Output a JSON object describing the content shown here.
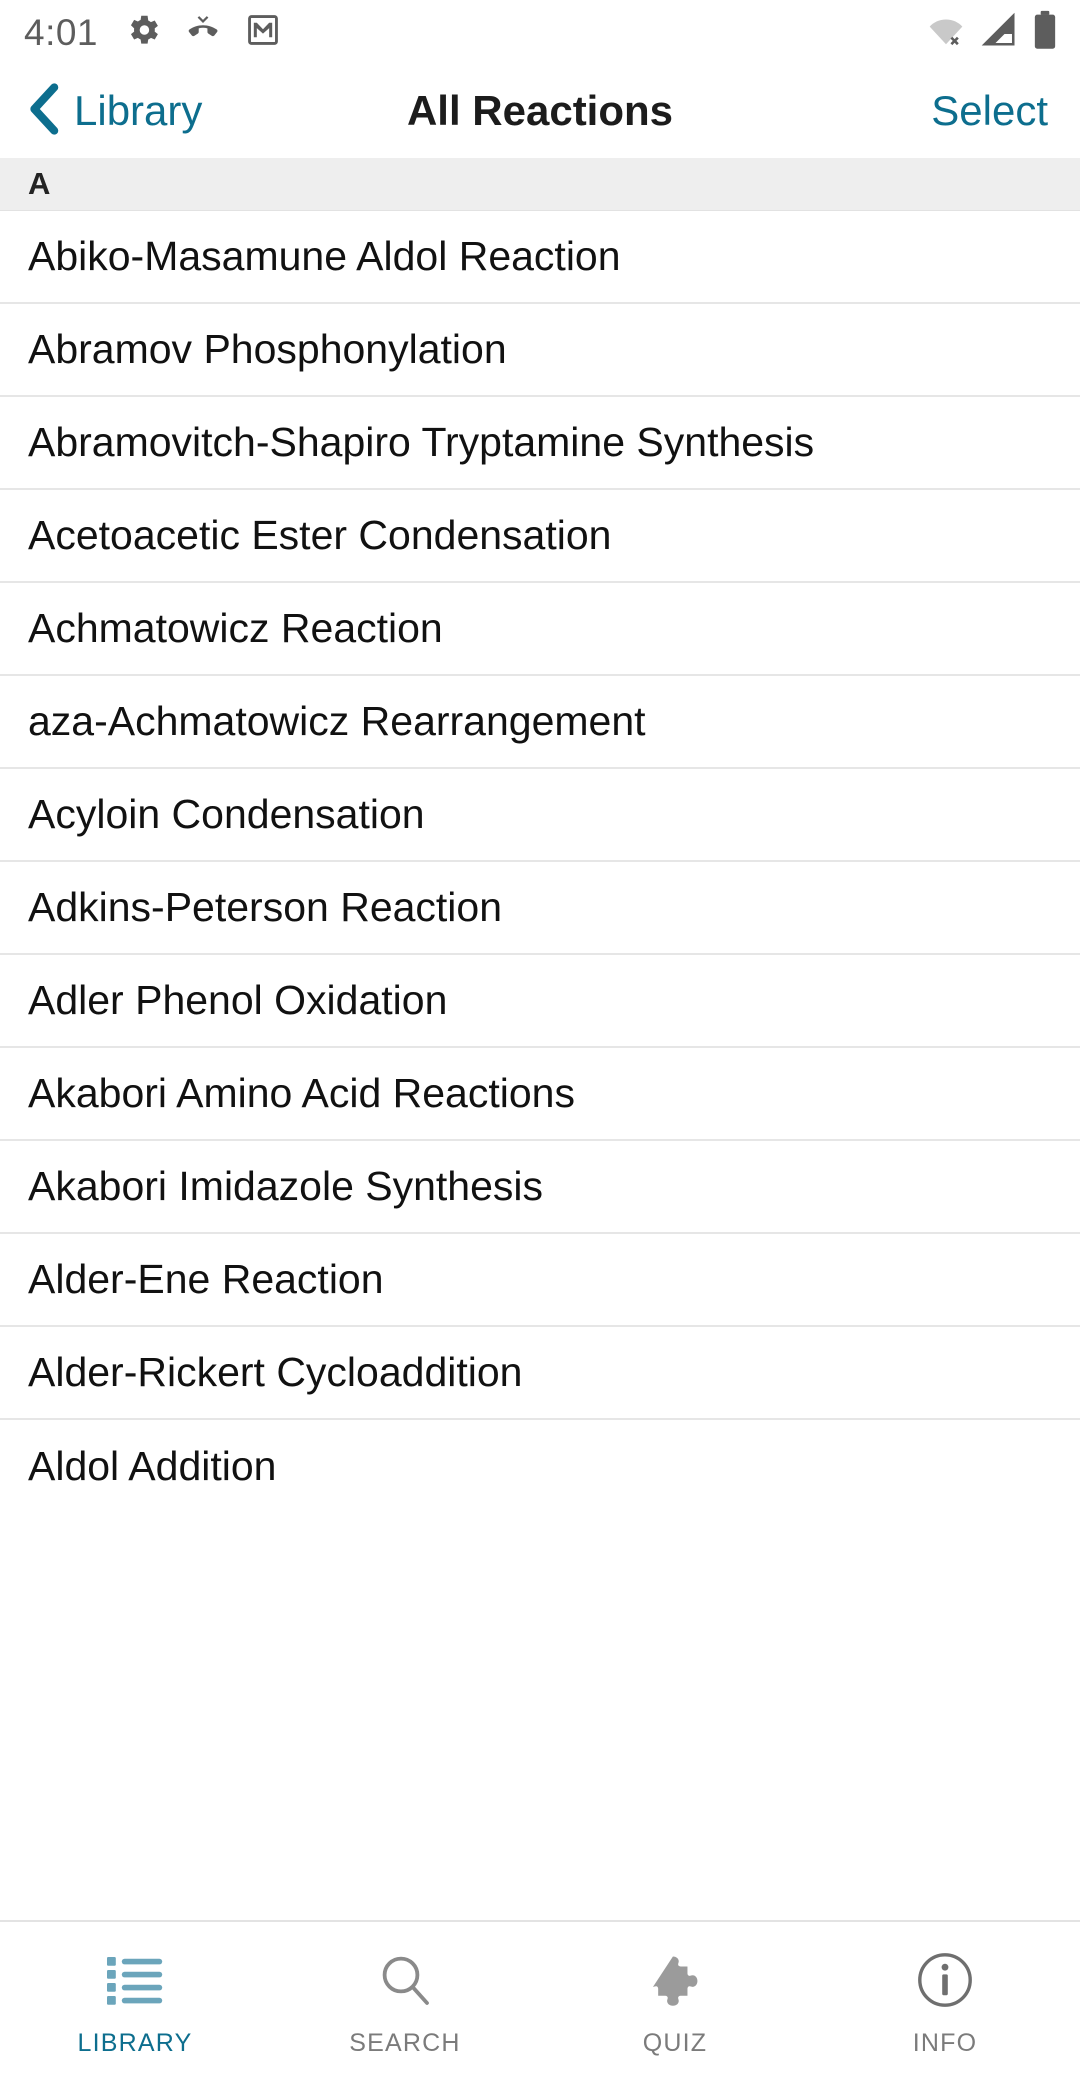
{
  "status_bar": {
    "time": "4:01",
    "left_icons": [
      "settings-gear-icon",
      "missed-call-icon",
      "gmail-icon"
    ],
    "right_icons": [
      "wifi-disconnected-icon",
      "cellular-signal-icon",
      "battery-full-icon"
    ]
  },
  "nav": {
    "back_label": "Library",
    "back_icon": "chevron-left-icon",
    "title": "All Reactions",
    "select_label": "Select"
  },
  "list": {
    "section_letter": "A",
    "items": [
      "Abiko-Masamune Aldol Reaction",
      "Abramov Phosphonylation",
      "Abramovitch-Shapiro Tryptamine Synthesis",
      "Acetoacetic Ester Condensation",
      "Achmatowicz Reaction",
      "aza-Achmatowicz Rearrangement",
      "Acyloin Condensation",
      "Adkins-Peterson Reaction",
      "Adler Phenol Oxidation",
      "Akabori Amino Acid Reactions",
      "Akabori Imidazole Synthesis",
      "Alder-Ene Reaction",
      "Alder-Rickert Cycloaddition"
    ],
    "clipped_item": "Aldol Addition"
  },
  "tabs": [
    {
      "label": "LIBRARY",
      "icon": "list-icon",
      "active": true
    },
    {
      "label": "SEARCH",
      "icon": "search-icon",
      "active": false
    },
    {
      "label": "QUIZ",
      "icon": "puzzle-piece-icon",
      "active": false
    },
    {
      "label": "INFO",
      "icon": "info-circle-icon",
      "active": false
    }
  ],
  "colors": {
    "accent_teal": "#0d6e8e",
    "tab_icon_active": "#6ba5bb",
    "tab_inactive": "#7b7b7b",
    "section_header_bg": "#eeeeee",
    "row_divider": "#e6e6e6",
    "status_icon": "#5d5d5d"
  }
}
